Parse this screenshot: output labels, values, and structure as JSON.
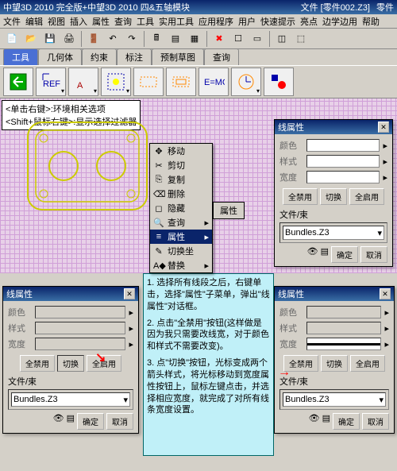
{
  "titlebar": {
    "app": "中望3D 2010 完全版+中望3D 2010 四&五轴模块",
    "file": "文件 [零件002.Z3]",
    "mode": "零件"
  },
  "menu": [
    "文件",
    "编辑",
    "视图",
    "插入",
    "属性",
    "查询",
    "工具",
    "实用工具",
    "应用程序",
    "用户",
    "快速提示",
    "亮点",
    "边学边用",
    "帮助"
  ],
  "tabs": [
    "工具",
    "几何体",
    "约束",
    "标注",
    "预制草图",
    "查询"
  ],
  "hint1": "<单击右键>:环境相关选项",
  "hint2": "<Shift+鼠标右键>:显示选择过滤器",
  "ctx": [
    {
      "icon": "✥",
      "label": "移动"
    },
    {
      "icon": "✂",
      "label": "剪切"
    },
    {
      "icon": "⎘",
      "label": "复制"
    },
    {
      "icon": "⌫",
      "label": "删除"
    },
    {
      "icon": "◻",
      "label": "隐藏"
    },
    {
      "icon": "🔍",
      "label": "查询",
      "arrow": "▸"
    },
    {
      "icon": "≡",
      "label": "属性",
      "sel": true
    },
    {
      "icon": "✎",
      "label": "切换坐"
    },
    {
      "icon": "A◆",
      "label": "替换",
      "arrow": "▸"
    }
  ],
  "submenu": "属性",
  "panel": {
    "title": "线属性",
    "rows": [
      {
        "l": "颜色"
      },
      {
        "l": "样式"
      },
      {
        "l": "宽度"
      }
    ],
    "btns": [
      "全禁用",
      "切换",
      "全启用"
    ],
    "sec": "文件/束",
    "bundle": "Bundles.Z3",
    "ok": "确定",
    "cancel": "取消"
  },
  "instr": {
    "p1": "1. 选择所有线段之后，右键单击，选择\"属性\"子菜单，弹出\"线属性\"对话框。",
    "p2": "2. 点击\"全禁用\"按钮(这样做是因为我只需要改线宽，对于颜色和样式不需要改变)。",
    "p3": "3. 点\"切换\"按钮，光标变成两个箭头样式，将光标移动到宽度属性按钮上，鼠标左键点击，并选择相应宽度，就完成了对所有线条宽度设置。"
  }
}
